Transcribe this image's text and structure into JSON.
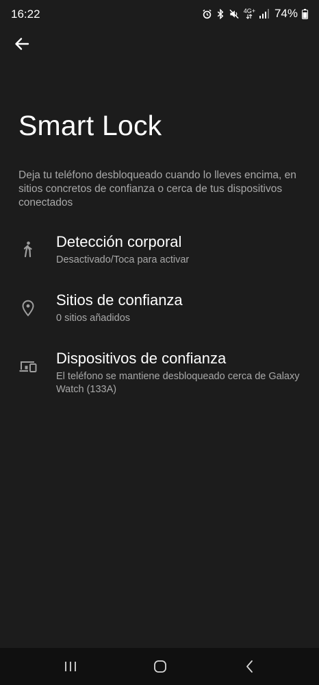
{
  "status_bar": {
    "time": "16:22",
    "network": "4G+",
    "battery": "74%",
    "icons": [
      "alarm-icon",
      "bluetooth-icon",
      "mute-icon",
      "network-4g-icon",
      "signal-icon",
      "battery-icon"
    ]
  },
  "header": {
    "back_icon": "arrow-left-icon"
  },
  "page": {
    "title": "Smart Lock",
    "description": "Deja tu teléfono desbloqueado cuando lo lleves encima, en sitios concretos de confianza o cerca de tus dispositivos conectados"
  },
  "settings": [
    {
      "icon": "walking-person-icon",
      "title": "Detección corporal",
      "subtitle": "Desactivado/Toca para activar"
    },
    {
      "icon": "location-pin-icon",
      "title": "Sitios de confianza",
      "subtitle": "0 sitios añadidos"
    },
    {
      "icon": "devices-icon",
      "title": "Dispositivos de confianza",
      "subtitle": "El teléfono se mantiene desbloqueado cerca de Galaxy Watch (133A)"
    }
  ],
  "nav_bar": {
    "icons": [
      "recents-icon",
      "home-icon",
      "back-icon"
    ]
  },
  "colors": {
    "background": "#1c1c1c",
    "text_primary": "#ffffff",
    "text_secondary": "#a9a9a9",
    "icon": "#9e9e9e",
    "nav_background": "#101010"
  }
}
